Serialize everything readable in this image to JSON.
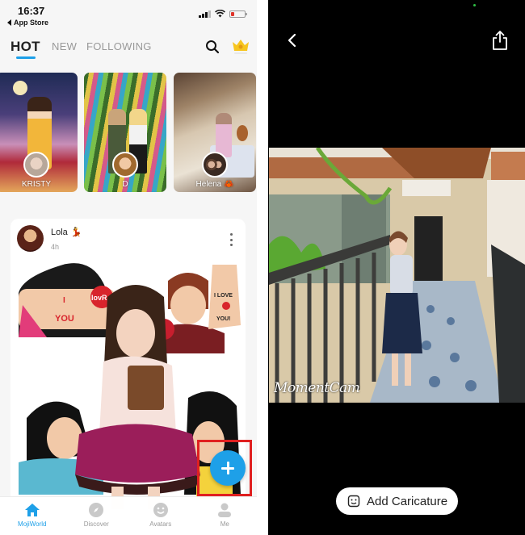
{
  "left_screen": {
    "status_bar": {
      "time": "16:37",
      "back_app": "App Store",
      "battery_color": "#e0352b"
    },
    "top_nav": {
      "tabs": [
        {
          "label": "HOT",
          "active": true
        },
        {
          "label": "NEW",
          "active": false
        },
        {
          "label": "FOLLOWING",
          "active": false
        }
      ],
      "search_icon": "search-icon",
      "vip_icon": "crown-icon",
      "accent_color": "#1ea0e8"
    },
    "hot_cards": [
      {
        "name": "KRISTY",
        "scene": "japanese-palace-night"
      },
      {
        "name": "D",
        "scene": "rainbow-escalator"
      },
      {
        "name": "Helena 🦀",
        "scene": "attic-bedroom"
      }
    ],
    "post": {
      "user": "Lola",
      "badge": "💃",
      "time": "4h",
      "more_icon": "more-vertical-icon",
      "image_description": "Caricature collage with 'I LOVE YOU' hand stickers and girls"
    },
    "fab": {
      "icon": "plus-icon",
      "color": "#1ea0e8",
      "highlight_color": "#e02020"
    },
    "bottom_nav": [
      {
        "label": "MojiWorld",
        "icon": "home-icon",
        "active": true
      },
      {
        "label": "Discover",
        "icon": "compass-icon",
        "active": false
      },
      {
        "label": "Avatars",
        "icon": "smiley-icon",
        "active": false
      },
      {
        "label": "Me",
        "icon": "person-icon",
        "active": false
      }
    ]
  },
  "right_screen": {
    "back_icon": "chevron-left-icon",
    "share_icon": "share-icon",
    "photo": {
      "description": "Woman standing on tiled balcony walkway",
      "watermark": "MomentCam"
    },
    "add_caricature_button": {
      "label": "Add Caricature",
      "icon": "caricature-face-icon"
    }
  }
}
